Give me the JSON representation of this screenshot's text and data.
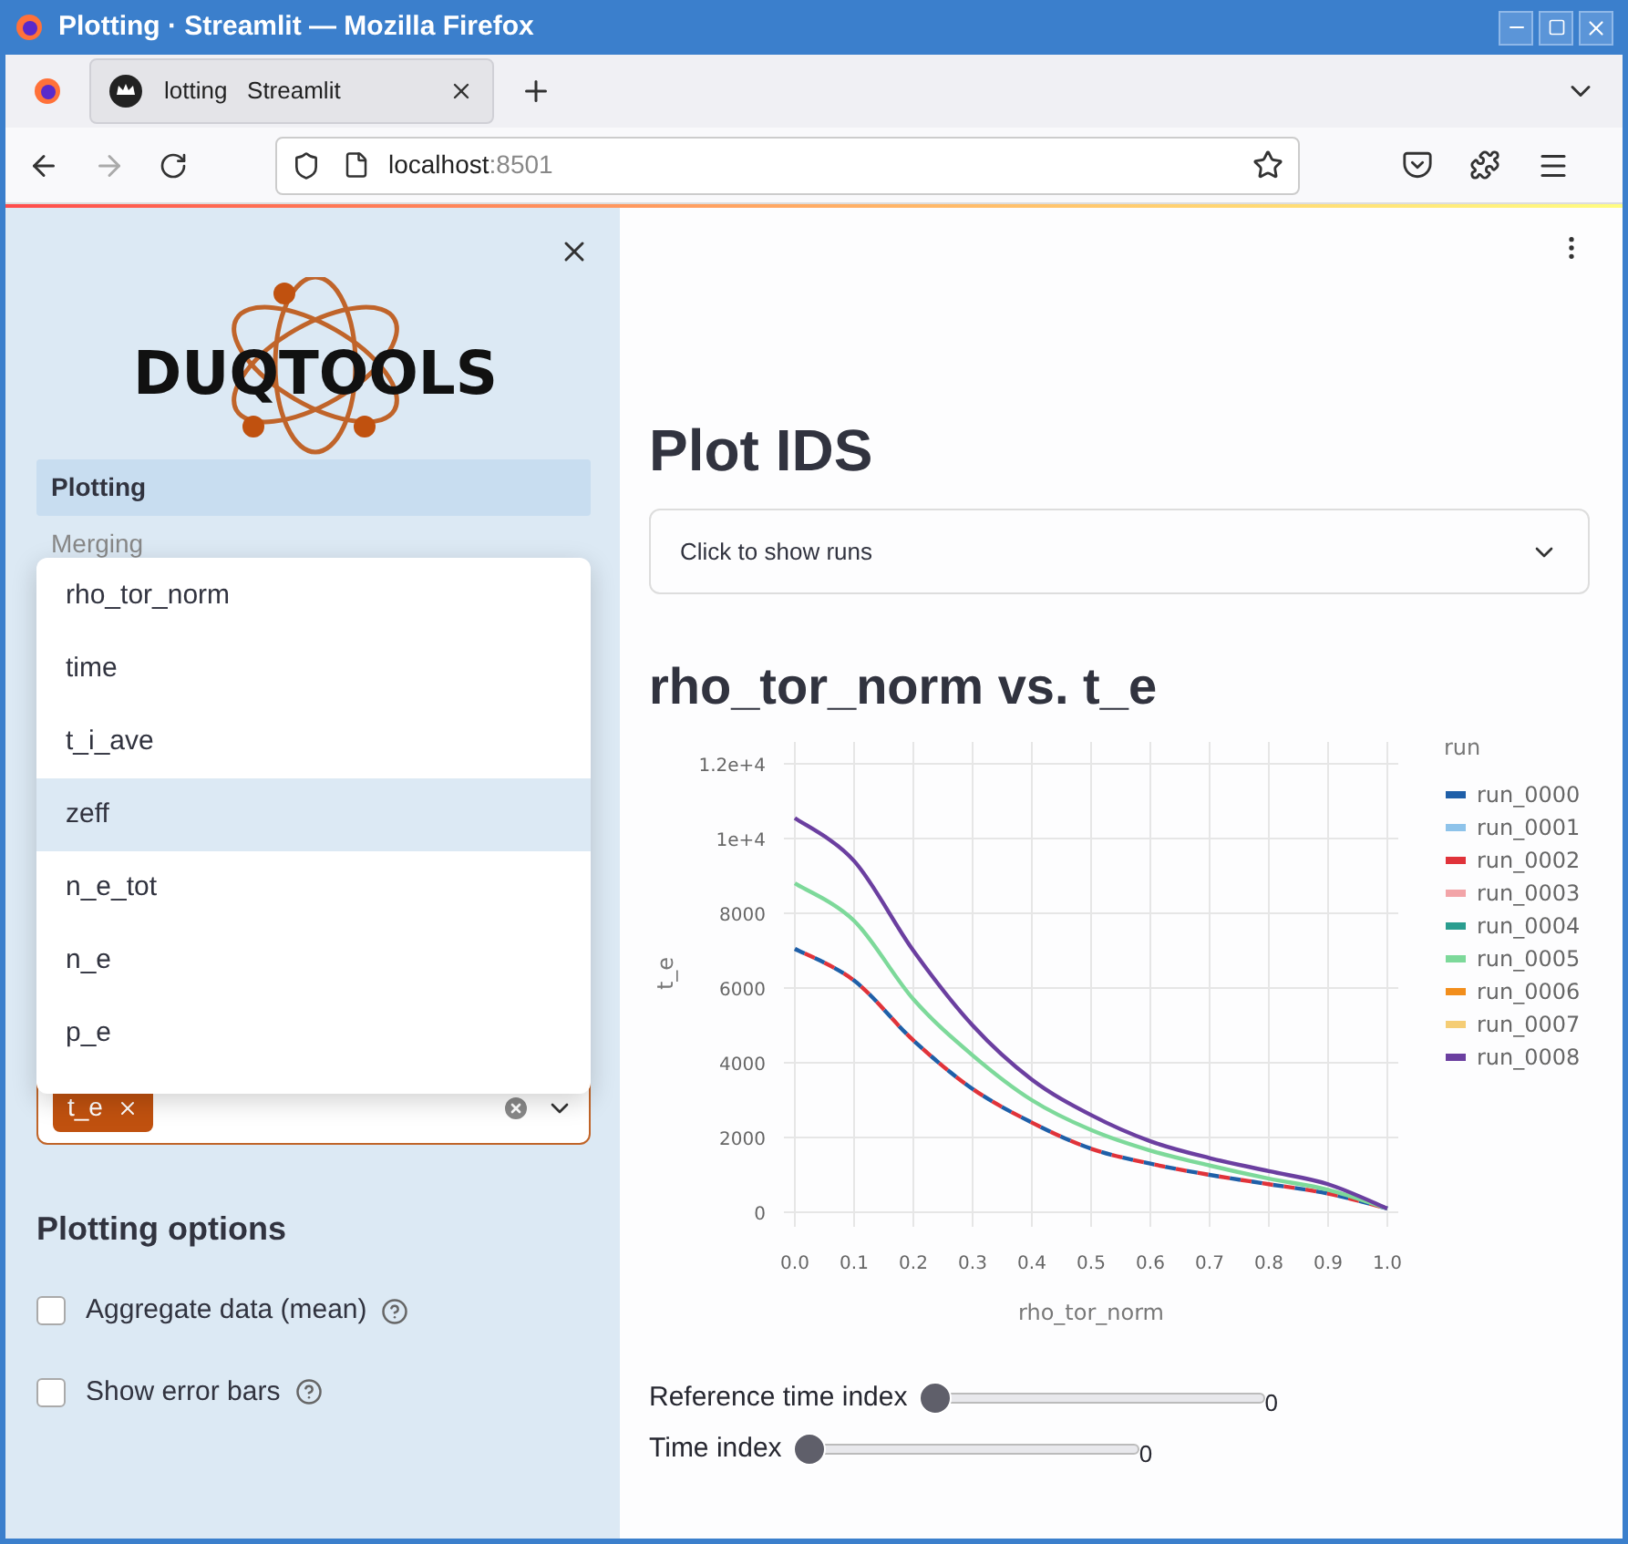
{
  "window": {
    "title": "Plotting · Streamlit — Mozilla Firefox"
  },
  "browser": {
    "tabs": [
      {
        "label": "lotting   Streamlit",
        "selected": true
      }
    ],
    "url_host": "localhost",
    "url_port": ":8501"
  },
  "sidebar": {
    "nav": [
      {
        "label": "Plotting",
        "selected": true
      },
      {
        "label": "Merging",
        "selected": false
      }
    ],
    "dropdown_options": [
      {
        "label": "rho_tor_norm",
        "highlighted": false
      },
      {
        "label": "time",
        "highlighted": false
      },
      {
        "label": "t_i_ave",
        "highlighted": false
      },
      {
        "label": "zeff",
        "highlighted": true
      },
      {
        "label": "n_e_tot",
        "highlighted": false
      },
      {
        "label": "n_e",
        "highlighted": false
      },
      {
        "label": "p_e",
        "highlighted": false
      }
    ],
    "logo_text": "DUQTOOLS",
    "multiselect": {
      "tags": [
        "t_e"
      ]
    },
    "options_title": "Plotting options",
    "checkboxes": [
      {
        "label": "Aggregate data (mean)",
        "checked": false
      },
      {
        "label": "Show error bars",
        "checked": false
      }
    ]
  },
  "main": {
    "title": "Plot IDS",
    "expander": {
      "label": "Click to show runs",
      "expanded": false
    },
    "chart_title": "rho_tor_norm vs. t_e",
    "chart_data": {
      "type": "line",
      "grid": true,
      "legend": true,
      "xlabel": "rho_tor_norm",
      "ylabel": "t_e",
      "legend_title": "run",
      "x": [
        0,
        0.1,
        0.2,
        0.3,
        0.4,
        0.5,
        0.6,
        0.7,
        0.8,
        0.9,
        1.0
      ],
      "xlim": [
        0,
        1
      ],
      "ylim": [
        0,
        12000
      ],
      "xticks": [
        {
          "value": 0,
          "label": "0.0"
        },
        0.1,
        0.2,
        0.3,
        0.4,
        0.5,
        0.6,
        0.7,
        0.8,
        0.9,
        {
          "value": 1,
          "label": "1.0"
        }
      ],
      "yticks": [
        0,
        2000,
        4000,
        6000,
        8000,
        {
          "value": 10000,
          "label": "1e+4"
        },
        {
          "value": 12000,
          "label": "1.2e+4"
        }
      ],
      "series": [
        {
          "name": "run_0000",
          "color": "#1f5fa8",
          "line_style": "dashed",
          "values": [
            7050,
            6200,
            4600,
            3300,
            2400,
            1700,
            1300,
            1000,
            750,
            500,
            100
          ]
        },
        {
          "name": "run_0001",
          "color": "#8ec3ea",
          "values": [
            null,
            null,
            null,
            null,
            null,
            null,
            null,
            null,
            null,
            null,
            null
          ]
        },
        {
          "name": "run_0002",
          "color": "#e0333a",
          "line_style": "dashed",
          "values": [
            7050,
            6200,
            4600,
            3300,
            2400,
            1700,
            1300,
            1000,
            750,
            500,
            100
          ]
        },
        {
          "name": "run_0003",
          "color": "#f2a4a8",
          "values": [
            null,
            null,
            null,
            null,
            null,
            null,
            null,
            null,
            null,
            null,
            null
          ]
        },
        {
          "name": "run_0004",
          "color": "#2a9d8f",
          "values": [
            null,
            null,
            null,
            null,
            null,
            null,
            null,
            null,
            null,
            null,
            null
          ]
        },
        {
          "name": "run_0005",
          "color": "#7dd99a",
          "line_style": "solid",
          "values": [
            8800,
            7800,
            5700,
            4200,
            3000,
            2200,
            1650,
            1250,
            900,
            600,
            100
          ]
        },
        {
          "name": "run_0006",
          "color": "#f28e1c",
          "values": [
            null,
            null,
            null,
            null,
            null,
            null,
            null,
            null,
            null,
            null,
            null
          ]
        },
        {
          "name": "run_0007",
          "color": "#f5cd75",
          "values": [
            null,
            null,
            null,
            null,
            null,
            null,
            null,
            null,
            null,
            null,
            null
          ]
        },
        {
          "name": "run_0008",
          "color": "#6b3fa0",
          "line_style": "solid",
          "values": [
            10550,
            9400,
            7000,
            5000,
            3550,
            2600,
            1900,
            1450,
            1100,
            750,
            100
          ]
        }
      ]
    },
    "sliders": [
      {
        "label": "Reference time index",
        "level": 0,
        "reading": "0"
      },
      {
        "label": "Time index",
        "level": 0,
        "reading": "0"
      }
    ]
  }
}
